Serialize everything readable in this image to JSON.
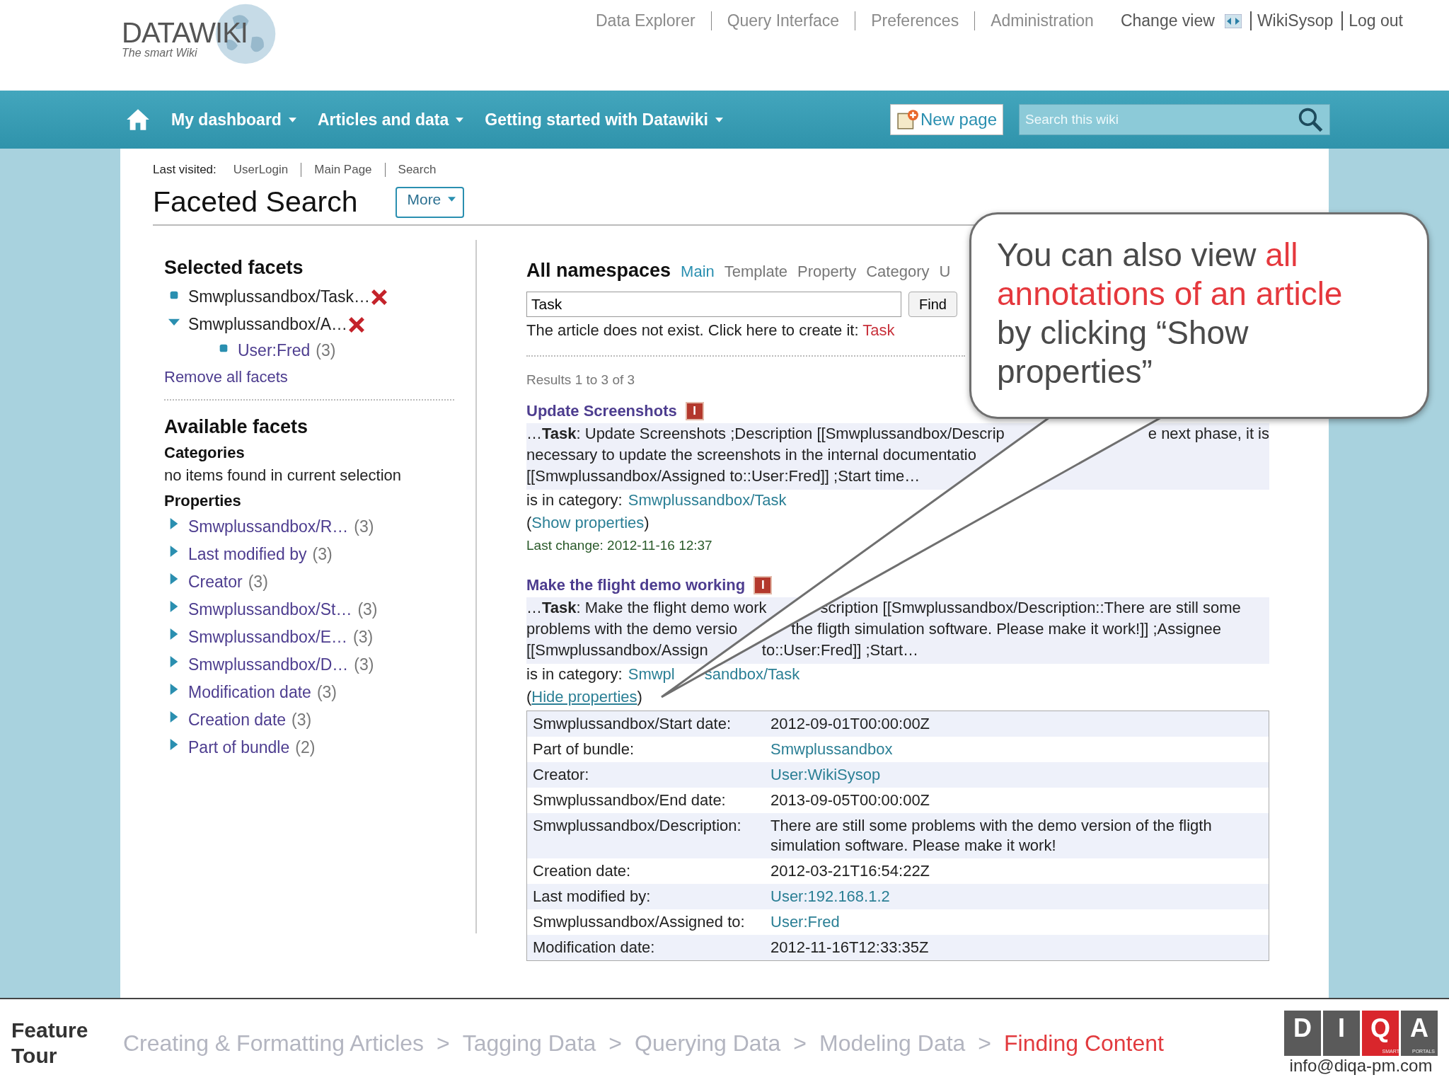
{
  "header": {
    "logo_title": "DATAWIKI",
    "logo_tagline": "The smart Wiki",
    "links": [
      "Data Explorer",
      "Query Interface",
      "Preferences",
      "Administration"
    ],
    "change_view": "Change view",
    "user_links": [
      "WikiSysop",
      "Log out"
    ]
  },
  "nav": {
    "items": [
      "My dashboard",
      "Articles and data",
      "Getting started with Datawiki"
    ],
    "new_page": "New page",
    "search_placeholder": "Search this wiki"
  },
  "breadcrumb": {
    "label": "Last visited:",
    "items": [
      "UserLogin",
      "Main Page",
      "Search"
    ]
  },
  "page_title": "Faceted Search",
  "more_button": "More",
  "selected_facets": {
    "heading": "Selected facets",
    "items": [
      {
        "label": "Smwplussandbox/Task…",
        "kind": "value"
      },
      {
        "label": "Smwplussandbox/A…",
        "kind": "property",
        "expanded": true,
        "children": [
          {
            "label": "User:Fred",
            "count": "(3)"
          }
        ]
      }
    ],
    "remove_all": "Remove all facets"
  },
  "available_facets": {
    "heading": "Available facets",
    "categories_heading": "Categories",
    "categories_empty": "no items found in current selection",
    "properties_heading": "Properties",
    "properties": [
      {
        "label": "Smwplussandbox/R…",
        "count": "(3)",
        "expanded": false
      },
      {
        "label": "Last modified by",
        "count": "(3)",
        "expanded": false
      },
      {
        "label": "Creator",
        "count": "(3)",
        "expanded": false
      },
      {
        "label": "Smwplussandbox/St…",
        "count": "(3)",
        "expanded": false
      },
      {
        "label": "Smwplussandbox/E…",
        "count": "(3)",
        "expanded": false
      },
      {
        "label": "Smwplussandbox/D…",
        "count": "(3)",
        "expanded": false
      },
      {
        "label": "Modification date",
        "count": "(3)",
        "expanded": false
      },
      {
        "label": "Creation date",
        "count": "(3)",
        "expanded": false
      },
      {
        "label": "Part of bundle",
        "count": "(2)",
        "expanded": false
      }
    ]
  },
  "namespaces": [
    {
      "label": "All namespaces",
      "selected": true
    },
    {
      "label": "Main",
      "selected": false
    },
    {
      "label": "Template",
      "selected": false
    },
    {
      "label": "Property",
      "selected": false
    },
    {
      "label": "Category",
      "selected": false
    },
    {
      "label": "U",
      "selected": false
    }
  ],
  "query": {
    "value": "Task",
    "find_button": "Find"
  },
  "notice": {
    "text": "The article does not exist. Click here to create it:",
    "link": "Task"
  },
  "results_summary": "Results 1 to 3 of 3",
  "results": [
    {
      "title": "Update Screenshots",
      "badge": "I",
      "snippet_lines": [
        [
          "…**Task**: Update Screenshots ;Description [[Smwplussandbox/Descrip",
          "e next phase, it is"
        ],
        [
          "necessary to update the screenshots in the internal documentatio"
        ],
        [
          "[[Smwplussandbox/Assigned to::User:Fred]] ;Start time…"
        ]
      ],
      "category_label": "is in category:",
      "category_link": [
        "Smwplussandbox/Task"
      ],
      "toggle": {
        "before": "(",
        "label": "Show properties",
        "after": ")",
        "expanded": false
      },
      "last_change": "Last change: 2012-11-16 12:37"
    },
    {
      "title": "Make the flight demo working",
      "badge": "I",
      "snippet_lines": [
        [
          "…**Task**: Make the flight demo work",
          "scription [[Smwplussandbox/Description::There are still some"
        ],
        [
          "problems with the demo versio",
          "the fligth simulation software. Please make it work!]] ;Assignee"
        ],
        [
          "[[Smwplussandbox/Assign",
          "to::User:Fred]] ;Start…"
        ]
      ],
      "category_label": "is in category:",
      "category_link": [
        "Smwpl",
        "sandbox/Task"
      ],
      "toggle": {
        "before": "(",
        "label": "Hide properties",
        "after": ")",
        "expanded": true
      },
      "properties": [
        {
          "label": "Smwplussandbox/Start date:",
          "value": "2012-09-01T00:00:00Z",
          "kind": "text"
        },
        {
          "label": "Part of bundle:",
          "value": "Smwplussandbox",
          "kind": "link"
        },
        {
          "label": "Creator:",
          "value": "User:WikiSysop",
          "kind": "link"
        },
        {
          "label": "Smwplussandbox/End date:",
          "value": "2013-09-05T00:00:00Z",
          "kind": "text"
        },
        {
          "label": "Smwplussandbox/Description:",
          "value": "There are still some problems with the demo version of the fligth simulation software. Please make it work!",
          "kind": "text"
        },
        {
          "label": "Creation date:",
          "value": "2012-03-21T16:54:22Z",
          "kind": "text"
        },
        {
          "label": "Last modified by:",
          "value": "User:192.168.1.2",
          "kind": "link"
        },
        {
          "label": "Smwplussandbox/Assigned to:",
          "value": "User:Fred",
          "kind": "link"
        },
        {
          "label": "Modification date:",
          "value": "2012-11-16T12:33:35Z",
          "kind": "text"
        }
      ]
    }
  ],
  "callout": [
    {
      "text": "You can also view ",
      "highlight": false
    },
    {
      "text": "all annotations of an article",
      "highlight": true
    },
    {
      "text": " by clicking “Show properties”",
      "highlight": false
    }
  ],
  "footer": {
    "label": "Feature Tour",
    "steps": [
      {
        "label": "Creating & Formatting Articles",
        "selected": false
      },
      {
        "separator": ">",
        "label": "Tagging Data",
        "selected": false
      },
      {
        "separator": ">",
        "label": "Querying Data",
        "selected": false
      },
      {
        "separator": ">",
        "label": "Modeling Data",
        "selected": false
      },
      {
        "separator": ">",
        "label": "Finding Content",
        "selected": true
      }
    ],
    "logo_letters": [
      {
        "char": "D",
        "highlight": false
      },
      {
        "char": "I",
        "highlight": false
      },
      {
        "char": "Q",
        "highlight": true
      },
      {
        "char": "A",
        "highlight": false
      }
    ],
    "logo_sub": [
      "SMART",
      "PORTALS"
    ],
    "email": "info@diqa-pm.com"
  }
}
